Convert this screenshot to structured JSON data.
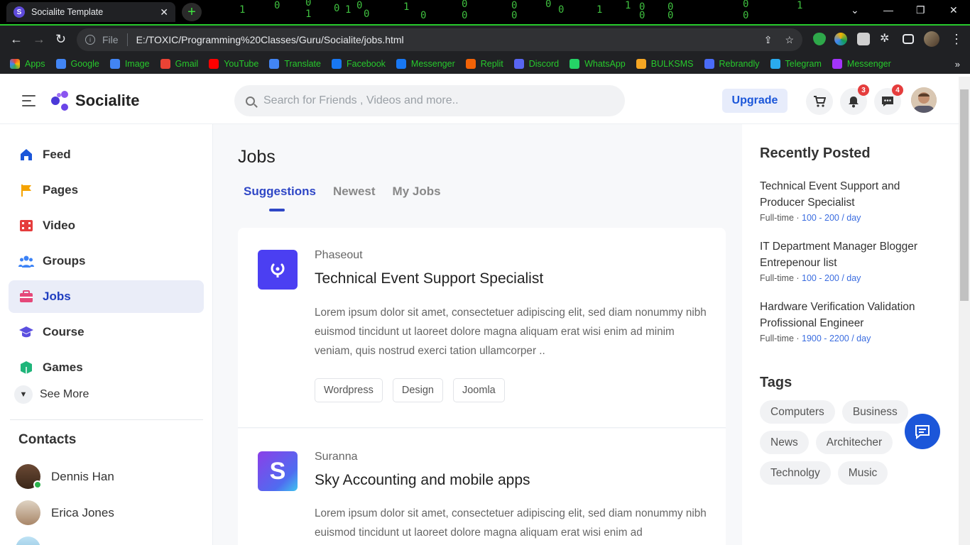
{
  "browser": {
    "tab_title": "Socialite Template",
    "tab_favicon_letter": "S",
    "file_label": "File",
    "url": "E:/TOXIC/Programming%20Classes/Guru/Socialite/jobs.html"
  },
  "bookmarks": [
    {
      "label": "Apps",
      "color": "#e94235"
    },
    {
      "label": "Google",
      "color": "#4285f4"
    },
    {
      "label": "Image",
      "color": "#4285f4"
    },
    {
      "label": "Gmail",
      "color": "#ea4335"
    },
    {
      "label": "YouTube",
      "color": "#ff0000"
    },
    {
      "label": "Translate",
      "color": "#4285f4"
    },
    {
      "label": "Facebook",
      "color": "#1877f2"
    },
    {
      "label": "Messenger",
      "color": "#1877f2"
    },
    {
      "label": "Replit",
      "color": "#f26207"
    },
    {
      "label": "Discord",
      "color": "#5865f2"
    },
    {
      "label": "WhatsApp",
      "color": "#25d366"
    },
    {
      "label": "BULKSMS",
      "color": "#f5a623"
    },
    {
      "label": "Rebrandly",
      "color": "#4a6cf7"
    },
    {
      "label": "Telegram",
      "color": "#2aabee"
    },
    {
      "label": "Messenger",
      "color": "#a334fa"
    }
  ],
  "header": {
    "brand": "Socialite",
    "search_placeholder": "Search for Friends , Videos and more..",
    "upgrade_label": "Upgrade",
    "notification_count": "3",
    "message_count": "4"
  },
  "sidebar": {
    "items": [
      {
        "label": "Feed",
        "color": "#1b56d9"
      },
      {
        "label": "Pages",
        "color": "#f5a300"
      },
      {
        "label": "Video",
        "color": "#e53d3d"
      },
      {
        "label": "Groups",
        "color": "#3b82f6"
      },
      {
        "label": "Jobs",
        "color": "#e5487a"
      },
      {
        "label": "Course",
        "color": "#5b4fe0"
      },
      {
        "label": "Games",
        "color": "#1fb57a"
      }
    ],
    "see_more": "See More",
    "contacts_title": "Contacts",
    "contacts": [
      "Dennis Han",
      "Erica Jones"
    ]
  },
  "main": {
    "title": "Jobs",
    "tabs": [
      "Suggestions",
      "Newest",
      "My Jobs"
    ],
    "jobs": [
      {
        "company": "Phaseout",
        "title": "Technical Event Support Specialist",
        "description": "Lorem ipsum dolor sit amet, consectetuer adipiscing elit, sed diam nonummy nibh euismod tincidunt ut laoreet dolore magna aliquam erat wisi enim ad minim veniam, quis nostrud exerci tation ullamcorper ..",
        "tags": [
          "Wordpress",
          "Design",
          "Joomla"
        ]
      },
      {
        "company": "Suranna",
        "logo_letter": "S",
        "title": "Sky Accounting and mobile apps",
        "description": "Lorem ipsum dolor sit amet, consectetuer adipiscing elit, sed diam nonummy nibh euismod tincidunt ut laoreet dolore magna aliquam erat wisi enim ad"
      }
    ]
  },
  "right": {
    "recent_title": "Recently Posted",
    "recent": [
      {
        "title": "Technical Event Support and Producer Specialist",
        "type": "Full-time",
        "pay": "100 - 200 / day"
      },
      {
        "title": "IT Department Manager Blogger Entrepenour list",
        "type": "Full-time",
        "pay": "100 - 200 / day"
      },
      {
        "title": "Hardware Verification Validation Profissional Engineer",
        "type": "Full-time",
        "pay": "1900 - 2200 / day"
      }
    ],
    "tags_title": "Tags",
    "tags": [
      "Computers",
      "Business",
      "News",
      "Architecher",
      "Technolgy",
      "Music"
    ]
  }
}
